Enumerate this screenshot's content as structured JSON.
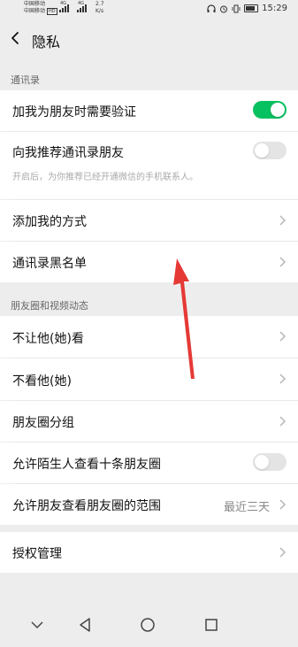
{
  "status_bar": {
    "carrier1": "中国移动",
    "carrier2": "中国移动",
    "net1": "4G",
    "net2": "4G",
    "speed_value": "2.7",
    "speed_unit": "K/s",
    "time": "15:29"
  },
  "header": {
    "title": "隐私",
    "back_icon": "chevron-left-icon"
  },
  "contacts_section": {
    "label": "通讯录",
    "require_verification": {
      "label": "加我为朋友时需要验证",
      "enabled": true
    },
    "recommend_contacts": {
      "label": "向我推荐通讯录朋友",
      "description": "开启后，为你推荐已经开通微信的手机联系人。",
      "enabled": false
    },
    "add_methods": {
      "label": "添加我的方式"
    },
    "blacklist": {
      "label": "通讯录黑名单"
    }
  },
  "moments_section": {
    "label": "朋友圈和视频动态",
    "hide_from": {
      "label": "不让他(她)看"
    },
    "dont_see": {
      "label": "不看他(她)"
    },
    "groups": {
      "label": "朋友圈分组"
    },
    "allow_strangers": {
      "label": "允许陌生人查看十条朋友圈",
      "enabled": false
    },
    "visible_range": {
      "label": "允许朋友查看朋友圈的范围",
      "value": "最近三天"
    }
  },
  "authorization": {
    "label": "授权管理"
  },
  "colors": {
    "accent": "#07c160",
    "background": "#ededed",
    "arrow": "#e53935"
  },
  "nav_bar": {
    "icons": [
      "chevron-down-icon",
      "back-triangle-icon",
      "home-circle-icon",
      "recents-square-icon"
    ]
  }
}
